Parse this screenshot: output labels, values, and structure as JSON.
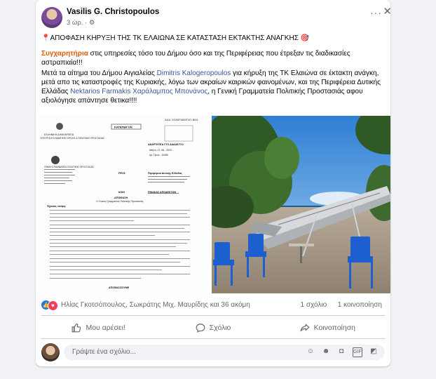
{
  "post": {
    "author": "Vasilis G. Christopoulos",
    "time": "3 ώρ.",
    "privacy_icon": "gear-icon",
    "more_icon": "more-horizontal-icon",
    "close_icon": "close-icon"
  },
  "content": {
    "headline": "ΑΠΟΦΑΣΗ ΚΗΡΥΞΗ ΤΗΣ ΤΚ ΕΛΑΙΩΝΑ ΣΕ ΚΑΤΑΣΤΑΣΗ ΕΚΤΑΚΤΗΣ ΑΝΑΓΚΗΣ",
    "p2_highlight": "Συγχαρητήρια",
    "p2_rest": " στις υπηρεσίες τόσο του Δήμου όσο και της Περιφέρειας που έτρεξαν τις διαδικασίες αστραπιαία!!!",
    "p3_a": "Μετά τα αίτημα του Δήμου Αιγιαλείας ",
    "p3_link1": "Dimitris Kalogeropoulos",
    "p3_b": " για κήρυξη της ΤΚ Ελαιώνα σε έκτακτη ανάγκη, μετά απο τις καταστροφές της Κυριακής, λόγω των ακραίων καιρικών φαινομένων, και της Περιφέρεια Δυτικής Ελλάδας ",
    "p3_link2": "Nektarios Farmakis",
    "p3_c": " ",
    "p3_link3": "Χαράλαμπος Μπονάνος",
    "p3_d": ", η Γενική Γραμματεία Πολιτικής Προστασιάς  αφου αξιολόγησε απάντησε θετικα!!!!"
  },
  "document": {
    "ada": "ΑΔΑ: ΨΩΜΠ46ΜΤΛΠ-ΒΜ1",
    "urgent": "ΚΑΤΕΠΕΙΓΟΝ",
    "republic": "ΕΛΛΗΝΙΚΗ ΔΗΜΟΚΡΑΤΙΑ",
    "ministry": "ΥΠΟΥΡΓΕΙΟ ΚΛΙΜΑΤΙΚΗΣ ΚΡΙΣΗΣ & ΠΟΛΙΤΙΚΗΣ ΠΡΟΣΤΑΣΙΑΣ",
    "secretariat": "ΓΕΝΙΚΗ ΓΡΑΜΜΑΤΕΙΑ ΠΟΛΙΤΙΚΗΣ ΠΡΟΣΤΑΣΙΑΣ",
    "post_label": "ΑΝΑΡΤΗΤΕΑ ΣΤΟ ΔΙΑΔΙΚΤΥΟ",
    "date": "Αθήνα, 17 -06 - 2023",
    "protocol": "Αρ. Πρωτ.: 10085",
    "to_label": "ΠΡΟΣ",
    "to_value": "Περιφέρεια Δυτικής Ελλάδας",
    "koin_label": "ΚΟΙΝ",
    "koin_value": "ΠΙΝΑΚΑΣ ΑΠΟΔΕΚΤΩΝ",
    "decision": "ΑΠΟΦΑΣΗ",
    "decision_sub": "Ο Γενικός Γραμματέας Πολιτικής Προστασίας",
    "considering": "Έχοντας υπόψη:",
    "decide": "ΑΠΟΦΑΣΙΖΟΥΜΕ"
  },
  "reactions": {
    "names": "Ηλίας Γκοτσόπουλος, Σωκράτης Μιχ. Μαυρίδης και 36 ακόμη",
    "comments": "1 σχόλιο",
    "shares": "1 κοινοποίηση"
  },
  "actions": {
    "like": "Μου αρέσει!",
    "comment": "Σχόλιο",
    "share": "Κοινοποίηση"
  },
  "composer": {
    "placeholder": "Γράψτε ένα σχόλιο..."
  },
  "colors": {
    "brand": "#1877f2",
    "highlight": "#e25b0b",
    "link": "#385898"
  }
}
